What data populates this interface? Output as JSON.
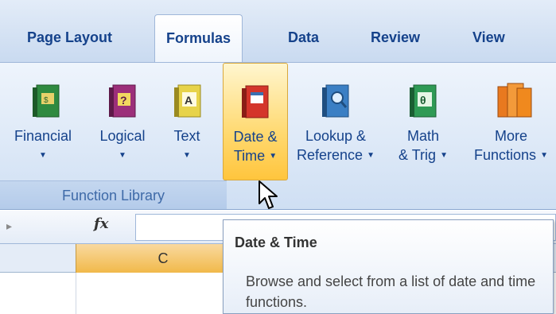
{
  "tabs": [
    {
      "label": "Page Layout"
    },
    {
      "label": "Formulas"
    },
    {
      "label": "Data"
    },
    {
      "label": "Review"
    },
    {
      "label": "View"
    }
  ],
  "ribbon": {
    "group_label": "Function Library",
    "buttons": [
      {
        "line1": "Financial",
        "line2": "",
        "icon": "financial-book-icon",
        "color": "#3a9a4a"
      },
      {
        "line1": "Logical",
        "line2": "",
        "icon": "logical-book-icon",
        "color": "#a0307e"
      },
      {
        "line1": "Text",
        "line2": "",
        "icon": "text-book-icon",
        "color": "#e0c93a"
      },
      {
        "line1": "Date &",
        "line2": "Time",
        "icon": "date-time-book-icon",
        "color": "#d73a2a"
      },
      {
        "line1": "Lookup &",
        "line2": "Reference",
        "icon": "lookup-book-icon",
        "color": "#3b7fc4"
      },
      {
        "line1": "Math",
        "line2": "& Trig",
        "icon": "math-book-icon",
        "color": "#3a9a5a"
      },
      {
        "line1": "More",
        "line2": "Functions",
        "icon": "more-functions-books-icon",
        "color": "#f0912e"
      }
    ]
  },
  "formula_bar": {
    "fx": "fx"
  },
  "grid": {
    "column_c": "C"
  },
  "tooltip": {
    "title": "Date & Time",
    "body": "Browse and select from a list of date and time functions."
  }
}
